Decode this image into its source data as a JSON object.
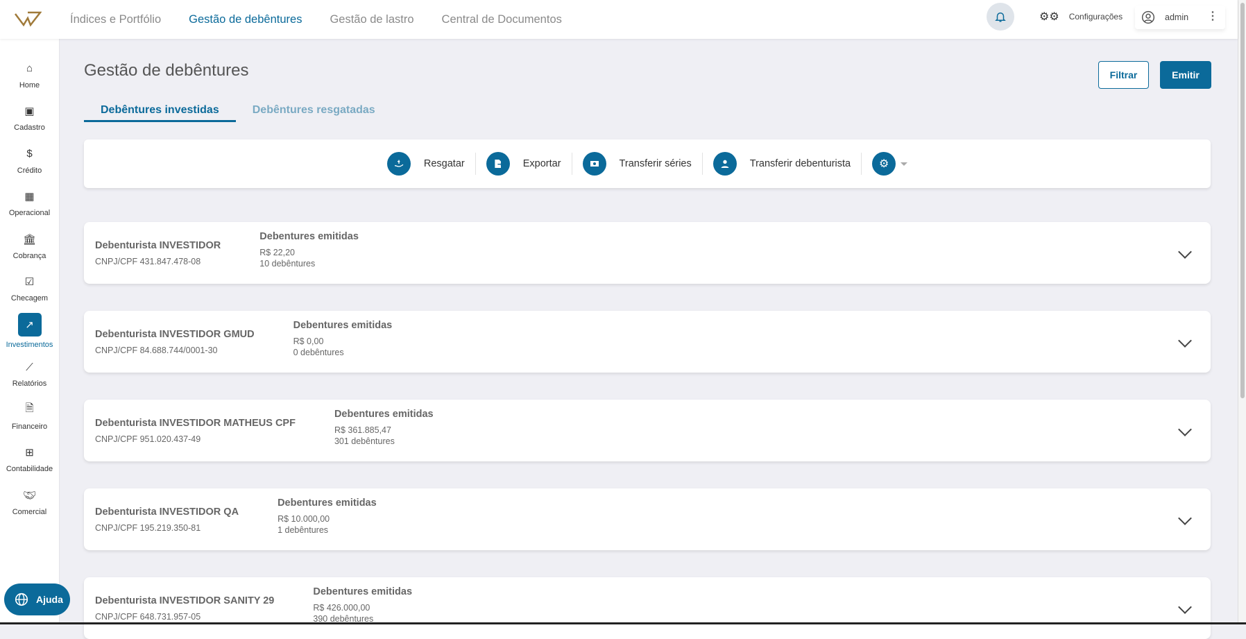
{
  "topnav": {
    "items": [
      "Índices e Portfólio",
      "Gestão de debêntures",
      "Gestão de lastro",
      "Central de Documentos"
    ],
    "config_label": "Configurações",
    "user": "admin"
  },
  "sidebar": {
    "items": [
      {
        "label": "Home",
        "icon": "home-icon"
      },
      {
        "label": "Cadastro",
        "icon": "contact-card-icon"
      },
      {
        "label": "Crédito",
        "icon": "hand-money-icon"
      },
      {
        "label": "Operacional",
        "icon": "calculator-icon"
      },
      {
        "label": "Cobrança",
        "icon": "bank-icon"
      },
      {
        "label": "Checagem",
        "icon": "calendar-check-icon"
      },
      {
        "label": "Investimentos",
        "icon": "investment-chart-icon"
      },
      {
        "label": "Relatórios",
        "icon": "line-chart-icon"
      },
      {
        "label": "Financeiro",
        "icon": "invoice-icon"
      },
      {
        "label": "Contabilidade",
        "icon": "grid-calc-icon"
      },
      {
        "label": "Comercial",
        "icon": "handshake-icon"
      }
    ],
    "help_label": "Ajuda"
  },
  "page": {
    "title": "Gestão de debêntures",
    "filter_label": "Filtrar",
    "emit_label": "Emitir",
    "tabs": [
      "Debêntures investidas",
      "Debêntures resgatadas"
    ]
  },
  "toolbar": {
    "actions": [
      "Resgatar",
      "Exportar",
      "Transferir séries",
      "Transferir debenturista"
    ]
  },
  "colors": {
    "accent": "#0b6a9a"
  },
  "cards": [
    {
      "name": "Debenturista INVESTIDOR",
      "doc": "CNPJ/CPF 431.847.478-08",
      "header": "Debentures emitidas",
      "value": "R$ 22,20",
      "count": "10 debêntures"
    },
    {
      "name": "Debenturista INVESTIDOR GMUD",
      "doc": "CNPJ/CPF 84.688.744/0001-30",
      "header": "Debentures emitidas",
      "value": "R$ 0,00",
      "count": "0 debêntures"
    },
    {
      "name": "Debenturista INVESTIDOR MATHEUS CPF",
      "doc": "CNPJ/CPF 951.020.437-49",
      "header": "Debentures emitidas",
      "value": "R$ 361.885,47",
      "count": "301 debêntures"
    },
    {
      "name": "Debenturista INVESTIDOR QA",
      "doc": "CNPJ/CPF 195.219.350-81",
      "header": "Debentures emitidas",
      "value": "R$ 10.000,00",
      "count": "1 debêntures"
    },
    {
      "name": "Debenturista INVESTIDOR SANITY 29",
      "doc": "CNPJ/CPF 648.731.957-05",
      "header": "Debentures emitidas",
      "value": "R$ 426.000,00",
      "count": "390 debêntures"
    }
  ]
}
